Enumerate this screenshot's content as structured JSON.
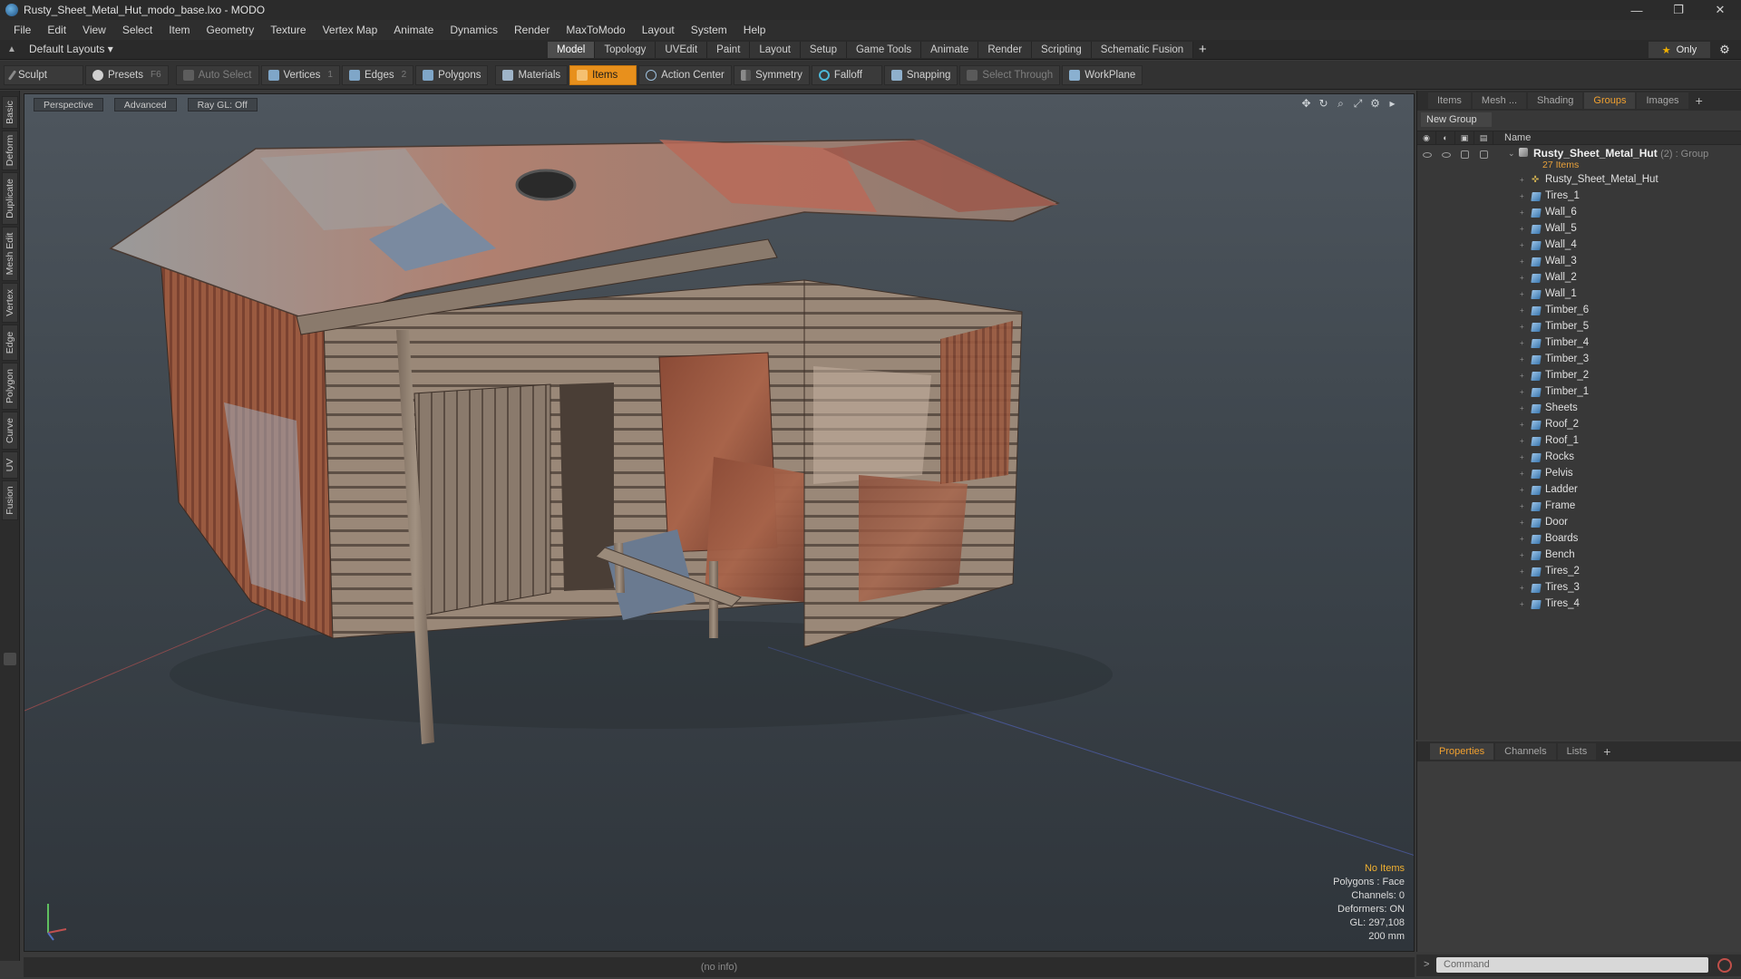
{
  "window": {
    "title": "Rusty_Sheet_Metal_Hut_modo_base.lxo - MODO",
    "controls": [
      "—",
      "❐",
      "✕"
    ]
  },
  "menu": [
    "File",
    "Edit",
    "View",
    "Select",
    "Item",
    "Geometry",
    "Texture",
    "Vertex Map",
    "Animate",
    "Dynamics",
    "Render",
    "MaxToModo",
    "Layout",
    "System",
    "Help"
  ],
  "layout": {
    "selector": "Default Layouts ▾",
    "tabs": [
      "Model",
      "Topology",
      "UVEdit",
      "Paint",
      "Layout",
      "Setup",
      "Game Tools",
      "Animate",
      "Render",
      "Scripting",
      "Schematic Fusion"
    ],
    "active_tab": "Model",
    "plus": "+",
    "only": "Only"
  },
  "toolbar": {
    "sculpt": "Sculpt",
    "presets": "Presets",
    "presets_key": "F6",
    "auto_select": "Auto Select",
    "vertices": "Vertices",
    "vertices_count": "1",
    "edges": "Edges",
    "edges_count": "2",
    "polygons": "Polygons",
    "materials": "Materials",
    "items": "Items",
    "action_center": "Action Center",
    "symmetry": "Symmetry",
    "falloff": "Falloff",
    "snapping": "Snapping",
    "select_through": "Select Through",
    "workplane": "WorkPlane"
  },
  "left_tabs": [
    "Basic",
    "Deform",
    "Duplicate",
    "Mesh Edit",
    "Vertex",
    "Edge",
    "Polygon",
    "Curve",
    "UV",
    "Fusion"
  ],
  "viewport": {
    "view_mode": "Perspective",
    "shading": "Advanced",
    "raygl": "Ray GL: Off",
    "hud": {
      "selection": "No Items",
      "polygons": "Polygons : Face",
      "channels": "Channels: 0",
      "deformers": "Deformers: ON",
      "gl": "GL: 297,108",
      "grid": "200 mm"
    }
  },
  "status": "(no info)",
  "groups_panel": {
    "tabs": [
      "Items",
      "Mesh ...",
      "Shading",
      "Groups",
      "Images"
    ],
    "active_tab": "Groups",
    "new_group": "New Group",
    "column_name": "Name",
    "group_name": "Rusty_Sheet_Metal_Hut",
    "group_suffix": "(2) : Group",
    "group_count": "27 Items",
    "items": [
      "Rusty_Sheet_Metal_Hut",
      "Tires_1",
      "Wall_6",
      "Wall_5",
      "Wall_4",
      "Wall_3",
      "Wall_2",
      "Wall_1",
      "Timber_6",
      "Timber_5",
      "Timber_4",
      "Timber_3",
      "Timber_2",
      "Timber_1",
      "Sheets",
      "Roof_2",
      "Roof_1",
      "Rocks",
      "Pelvis",
      "Ladder",
      "Frame",
      "Door",
      "Boards",
      "Bench",
      "Tires_2",
      "Tires_3",
      "Tires_4"
    ]
  },
  "properties_panel": {
    "tabs": [
      "Properties",
      "Channels",
      "Lists"
    ],
    "active_tab": "Properties"
  },
  "command": {
    "placeholder": "Command"
  },
  "colors": {
    "accent": "#e8901c",
    "group_sub": "#e8a13a",
    "hud_warn": "#f0b030"
  }
}
